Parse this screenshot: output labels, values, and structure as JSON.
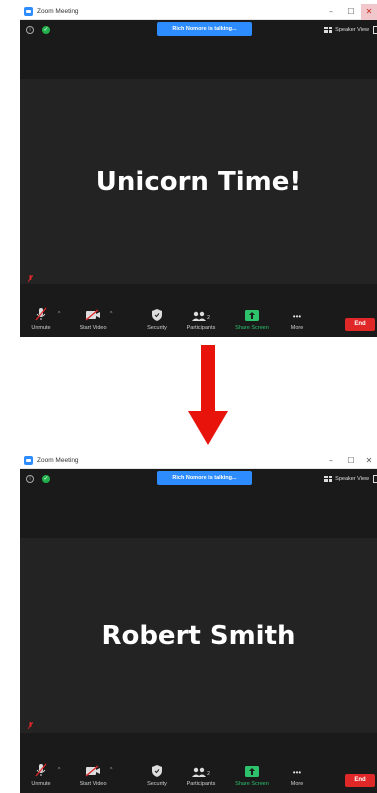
{
  "screens": [
    {
      "window_title": "Zoom Meeting",
      "minimize": "–",
      "maximize": "☐",
      "close": "✕",
      "talking_banner": "Rich Nomore is talking...",
      "speaker_view": "Speaker View",
      "participant_name": "Unicorn Time!",
      "toolbar": {
        "unmute": "Unmute",
        "start_video": "Start Video",
        "security": "Security",
        "participants": "Participants",
        "participants_count": "2",
        "share_screen": "Share Screen",
        "more": "More",
        "end": "End"
      }
    },
    {
      "window_title": "Zoom Meeting",
      "minimize": "–",
      "maximize": "☐",
      "close": "✕",
      "talking_banner": "Rich Nomore is talking...",
      "speaker_view": "Speaker View",
      "participant_name": "Robert Smith",
      "toolbar": {
        "unmute": "Unmute",
        "start_video": "Start Video",
        "security": "Security",
        "participants": "Participants",
        "participants_count": "2",
        "share_screen": "Share Screen",
        "more": "More",
        "end": "End"
      }
    }
  ],
  "colors": {
    "banner": "#2d8cff",
    "share_green": "#2dc26b",
    "end_red": "#e02828",
    "arrow_red": "#e8140c",
    "background": "#1a1a1a"
  },
  "icons": [
    "zoom-app-icon",
    "info-icon",
    "shield-check-icon",
    "grid-icon",
    "mic-muted-icon",
    "video-off-icon",
    "security-shield-icon",
    "participants-icon",
    "share-screen-icon",
    "more-icon",
    "down-arrow-icon"
  ]
}
